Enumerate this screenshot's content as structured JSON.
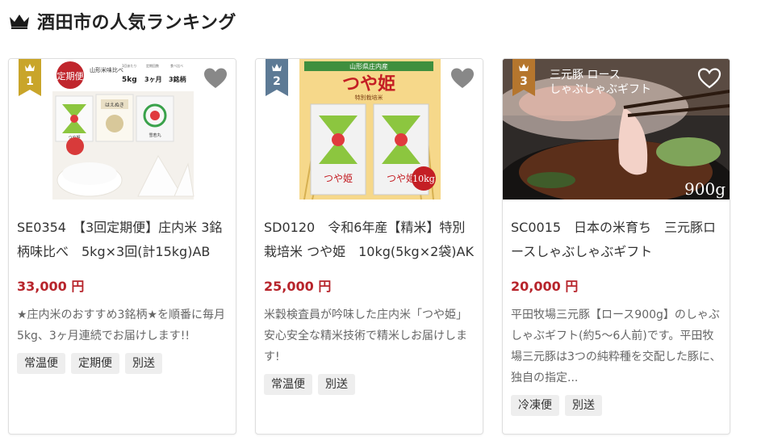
{
  "section": {
    "title": "酒田市の人気ランキング",
    "crown_icon": "crown-icon"
  },
  "colors": {
    "price": "#b7242b",
    "rank_1": "#c9a52a",
    "rank_2": "#5d7a95",
    "rank_3": "#b5762e"
  },
  "products": [
    {
      "rank": "1",
      "name": "SE0354　【3回定期便】庄内米 3銘柄味比べ　5kg×3回(計15kg)AB",
      "price": "33,000 円",
      "description": "★庄内米のおすすめ3銘柄★を順番に毎月5kg、3ヶ月連続でお届けします!!",
      "tags": [
        "常温便",
        "定期便",
        "別送"
      ],
      "image": {
        "badge": "定期便",
        "header_label": "山形米味比べ",
        "header_note_1": "1回あたり",
        "header_note_2": "定期回数",
        "header_note_3": "食べ比べ",
        "weight": "5kg",
        "months": "3ヶ月",
        "brands": "3銘柄",
        "bag_1": "つや姫",
        "bag_2": "はえぬき",
        "bag_3": "雪若丸"
      }
    },
    {
      "rank": "2",
      "name": "SD0120　令和6年産【精米】特別栽培米 つや姫　10kg(5kg×2袋)AK",
      "price": "25,000 円",
      "description": "米穀検査員が吟味した庄内米「つや姫」　安心安全な精米技術で精米しお届けします!",
      "tags": [
        "常温便",
        "別送"
      ],
      "image": {
        "banner": "山形県庄内産",
        "brand": "つや姫",
        "subtitle": "特別栽培米",
        "bag_label": "つや姫",
        "weight": "10kg"
      }
    },
    {
      "rank": "3",
      "name": "SC0015　日本の米育ち　三元豚ロースしゃぶしゃぶギフト",
      "price": "20,000 円",
      "description": "平田牧場三元豚【ロース900g】のしゃぶしゃぶギフト(約5～6人前)です。平田牧場三元豚は3つの純粋種を交配した豚に、独自の指定...",
      "tags": [
        "冷凍便",
        "別送"
      ],
      "image": {
        "line_1": "三元豚 ロース",
        "line_2": "しゃぶしゃぶギフト",
        "weight": "900g"
      }
    }
  ]
}
